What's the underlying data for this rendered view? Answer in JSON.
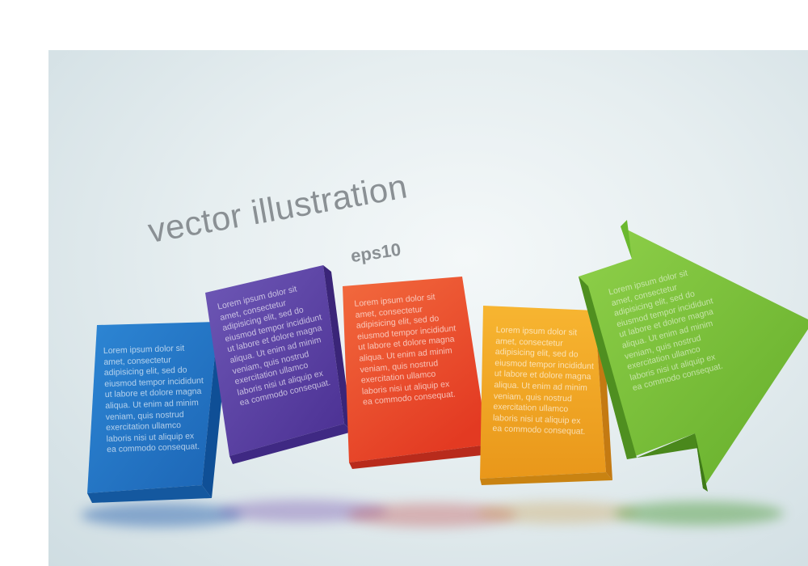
{
  "title": "vector illustration",
  "subtitle": "eps10",
  "cards": [
    {
      "id": "blue",
      "color": "#1f6fc0",
      "text": "Lorem ipsum dolor sit\namet, consectetur\nadipisicing elit, sed do\neiusmod tempor incididunt\nut labore et dolore magna\naliqua. Ut enim ad minim\nveniam, quis nostrud\nexercitation ullamco\nlaboris nisi ut aliquip ex\nea commodo consequat."
    },
    {
      "id": "purple",
      "color": "#5a3fa3",
      "text": "Lorem ipsum dolor sit\namet, consectetur\nadipisicing elit, sed do\neiusmod tempor incididunt\nut labore et dolore magna\naliqua. Ut enim ad minim\nveniam, quis nostrud\nexercitation ullamco\nlaboris nisi ut aliquip ex\nea commodo consequat."
    },
    {
      "id": "red",
      "color": "#e8452a",
      "text": "Lorem ipsum dolor sit\namet, consectetur\nadipisicing elit, sed do\neiusmod tempor incididunt\nut labore et dolore magna\naliqua. Ut enim ad minim\nveniam, quis nostrud\nexercitation ullamco\nlaboris nisi ut aliquip ex\nea commodo consequat."
    },
    {
      "id": "orange",
      "color": "#f2a51f",
      "text": "Lorem ipsum dolor sit\namet, consectetur\nadipisicing elit, sed do\neiusmod tempor incididunt\nut labore et dolore magna\naliqua. Ut enim ad minim\nveniam, quis nostrud\nexercitation ullamco\nlaboris nisi ut aliquip ex\nea commodo consequat."
    },
    {
      "id": "green",
      "color": "#7cc23a",
      "text": "Lorem ipsum dolor sit\namet, consectetur\nadipisicing elit, sed do\neiusmod tempor incididunt\nut labore et dolore magna\naliqua. Ut enim ad minim\nveniam, quis nostrud\nexercitation ullamco\nlaboris nisi ut aliquip ex\nea commodo consequat."
    }
  ]
}
